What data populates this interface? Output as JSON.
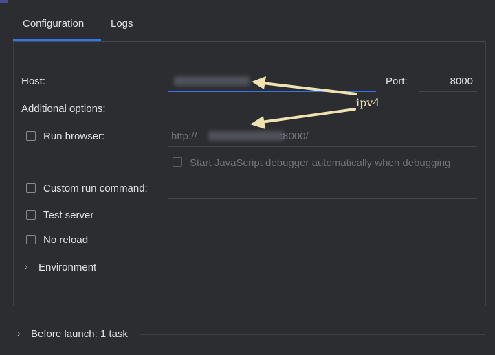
{
  "tabs": [
    {
      "label": "Configuration",
      "active": true
    },
    {
      "label": "Logs",
      "active": false
    }
  ],
  "config": {
    "host_label": "Host:",
    "port_label": "Port:",
    "port_value": "8000",
    "additional_options_label": "Additional options:",
    "run_browser_label": "Run browser:",
    "browser_url_prefix": "http://",
    "browser_url_suffix": ":8000/",
    "js_debugger_label": "Start JavaScript debugger automatically when debugging",
    "custom_run_command_label": "Custom run command:",
    "test_server_label": "Test server",
    "no_reload_label": "No reload",
    "environment_label": "Environment"
  },
  "before_launch_label": "Before launch: 1 task",
  "annotation": {
    "text": "ipv4",
    "color": "#f0e2b0"
  },
  "colors": {
    "accent": "#3574f0",
    "background": "#2b2d30"
  }
}
